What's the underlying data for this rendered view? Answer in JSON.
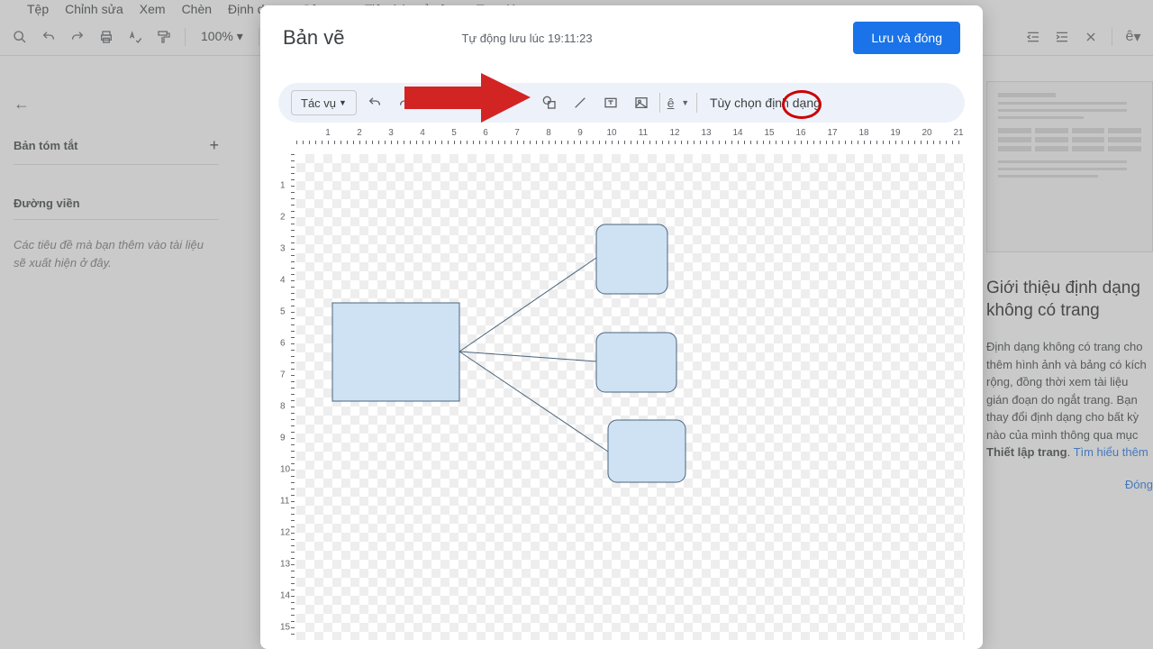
{
  "menu": {
    "file": "Tệp",
    "edit": "Chỉnh sửa",
    "view": "Xem",
    "insert": "Chèn",
    "format": "Định dạng",
    "tools": "Công cụ",
    "ext": "Tiện ích mở rộng",
    "help": "Trợ giúp"
  },
  "toolbar": {
    "zoom": "100%"
  },
  "left": {
    "summary": "Bản tóm tắt",
    "outline": "Đường viền",
    "outline_body": "Các tiêu đề mà bạn thêm vào tài liệu sẽ xuất hiện ở đây."
  },
  "right": {
    "title": "Giới thiệu định dạng không có trang",
    "text_a": "Định dạng không có trang cho thêm hình ảnh và bảng có kích rộng, đồng thời xem tài liệu gián đoạn do ngắt trang. Bạn thay đổi định dạng cho bất kỳ nào của mình thông qua mục ",
    "setup": "Thiết lập trang",
    "learn": "Tìm hiểu thêm",
    "close": "Đóng"
  },
  "dialog": {
    "title": "Bản vẽ",
    "status": "Tự động lưu lúc 19:11:23",
    "save": "Lưu và đóng",
    "actions": "Tác vụ",
    "format_opts": "Tùy chọn định dạng",
    "e_char": "ê"
  }
}
